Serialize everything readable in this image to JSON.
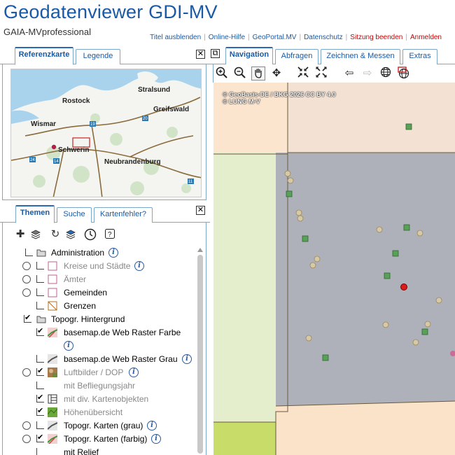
{
  "header": {
    "title": "Geodatenviewer GDI-MV",
    "subtitle": "GAIA-MVprofessional",
    "links": [
      "Titel ausblenden",
      "Online-Hilfe",
      "GeoPortal.MV",
      "Datenschutz",
      "Sitzung beenden",
      "Anmelden"
    ]
  },
  "ref_panel": {
    "tabs": [
      "Referenzkarte",
      "Legende"
    ],
    "close": "✕",
    "cities": [
      "Stralsund",
      "Rostock",
      "Greifswald",
      "Wismar",
      "Schwerin",
      "Neubrandenburg"
    ],
    "road_shields": [
      "19",
      "20",
      "24",
      "14",
      "11"
    ]
  },
  "theme_panel": {
    "tabs": [
      "Themen",
      "Suche",
      "Kartenfehler?"
    ],
    "close": "✕",
    "info_glyph": "i",
    "layers": [
      {
        "label": "Administration"
      },
      {
        "label": "Kreise und Städte"
      },
      {
        "label": "Ämter"
      },
      {
        "label": "Gemeinden"
      },
      {
        "label": "Grenzen"
      },
      {
        "label": "Topogr. Hintergrund"
      },
      {
        "label": "basemap.de Web Raster Farbe"
      },
      {
        "label": "basemap.de Web Raster Grau"
      },
      {
        "label": "Luftbilder / DOP"
      },
      {
        "label": "mit Befliegungsjahr"
      },
      {
        "label": "mit div. Kartenobjekten"
      },
      {
        "label": "Höhenübersicht"
      },
      {
        "label": "Topogr. Karten (grau)"
      },
      {
        "label": "Topogr. Karten (farbig)"
      },
      {
        "label": "mit Relief"
      }
    ]
  },
  "nav_panel": {
    "tabs": [
      "Navigation",
      "Abfragen",
      "Zeichnen & Messen",
      "Extras"
    ],
    "copyright": [
      "© GeoBasis-DE / BKG 2026 CC BY 4.0",
      "© LUNG M-V"
    ]
  },
  "colors": {
    "brand": "#1a5aa5",
    "link_red": "#cc0000",
    "tab_border": "#7aa7cc"
  }
}
